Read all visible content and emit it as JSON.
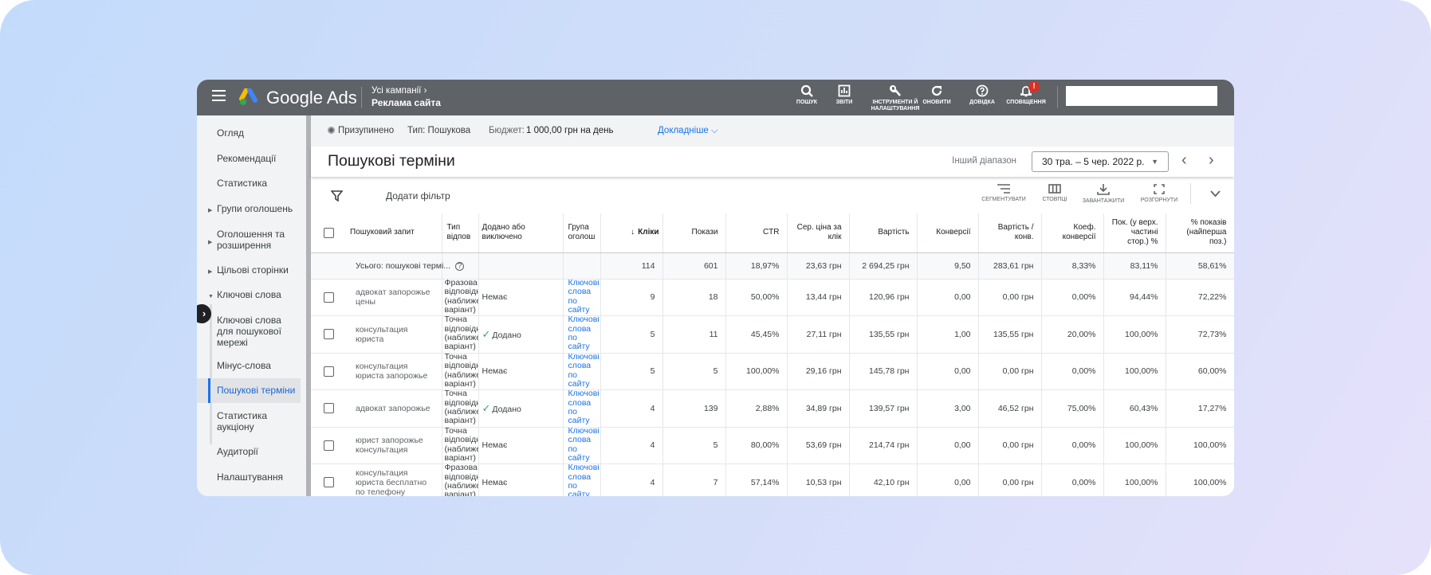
{
  "colors": {
    "header": "#5f6368",
    "accent": "#1a73e8",
    "added": "#34a853",
    "badge": "#d93025"
  },
  "header": {
    "brand": "Google Ads",
    "breadcrumb": {
      "parent": "Усі кампанії",
      "current": "Реклама сайта"
    },
    "buttons": [
      {
        "icon": "search-icon",
        "label": "пошук"
      },
      {
        "icon": "reports-icon",
        "label": "звіти"
      },
      {
        "icon": "wrench-icon",
        "label": "інструменти й налаштування"
      },
      {
        "icon": "refresh-icon",
        "label": "оновити"
      },
      {
        "icon": "help-icon",
        "label": "довідка"
      },
      {
        "icon": "bell-icon",
        "label": "сповіщення",
        "badge": "!"
      }
    ]
  },
  "sidebar": {
    "items": [
      {
        "label": "Огляд"
      },
      {
        "label": "Рекомендації"
      },
      {
        "label": "Статистика"
      },
      {
        "label": "Групи оголошень",
        "expandable": true
      },
      {
        "label": "Оголошення та розширення",
        "expandable": true
      },
      {
        "label": "Цільові сторінки",
        "expandable": true
      },
      {
        "label": "Ключові слова",
        "expanded": true
      },
      {
        "label": "Ключові слова для пошукової мережі",
        "sub": true
      },
      {
        "label": "Мінус-слова",
        "sub": true
      },
      {
        "label": "Пошукові терміни",
        "sub": true,
        "active": true
      },
      {
        "label": "Статистика аукціону",
        "sub": true
      },
      {
        "label": "Аудиторії"
      },
      {
        "label": "Налаштування"
      }
    ]
  },
  "campaign": {
    "status": "Призупинено",
    "type": "Тип: Пошукова",
    "budget_label": "Бюджет:",
    "budget": "1 000,00 грн на день",
    "more": "Докладніше"
  },
  "page": {
    "title": "Пошукові терміни",
    "range_label": "Інший діапазон",
    "date_range": "30 тра. – 5 чер. 2022 р."
  },
  "toolbar": {
    "add_filter": "Додати фільтр",
    "segment": "сегментувати",
    "columns": "стовпці",
    "download": "завантажити",
    "expand": "розгорнути"
  },
  "table": {
    "columns": [
      "Пошуковий запит",
      "Тип відпов",
      "Додано або виключено",
      "Група оголош",
      "Кліки",
      "Покази",
      "CTR",
      "Сер. ціна за клік",
      "Вартість",
      "Конверсії",
      "Вартість / конв.",
      "Коеф. конверсії",
      "Пок. (у верх. частині стор.) %",
      "% показів (найперша поз.)"
    ],
    "sorted_column": "Кліки",
    "sort_direction": "descending",
    "total": [
      "Усього: пошукові термі...",
      "",
      "",
      "",
      "114",
      "601",
      "18,97%",
      "23,63 грн",
      "2 694,25 грн",
      "9,50",
      "283,61 грн",
      "8,33%",
      "83,11%",
      "58,61%"
    ],
    "rows": [
      [
        "адвокат запорожье цены",
        "Фразова відповідність (наближений варіант)",
        "Немає",
        "Ключові слова по сайту",
        "9",
        "18",
        "50,00%",
        "13,44 грн",
        "120,96 грн",
        "0,00",
        "0,00 грн",
        "0,00%",
        "94,44%",
        "72,22%"
      ],
      [
        "консультация юриста",
        "Точна відповідність (наближений варіант)",
        "Додано",
        "Ключові слова по сайту",
        "5",
        "11",
        "45,45%",
        "27,11 грн",
        "135,55 грн",
        "1,00",
        "135,55 грн",
        "20,00%",
        "100,00%",
        "72,73%"
      ],
      [
        "консультация юриста запорожье",
        "Точна відповідність (наближений варіант)",
        "Немає",
        "Ключові слова по сайту",
        "5",
        "5",
        "100,00%",
        "29,16 грн",
        "145,78 грн",
        "0,00",
        "0,00 грн",
        "0,00%",
        "100,00%",
        "60,00%"
      ],
      [
        "адвокат запорожье",
        "Точна відповідність (наближений варіант)",
        "Додано",
        "Ключові слова по сайту",
        "4",
        "139",
        "2,88%",
        "34,89 грн",
        "139,57 грн",
        "3,00",
        "46,52 грн",
        "75,00%",
        "60,43%",
        "17,27%"
      ],
      [
        "юрист запорожье консультация",
        "Точна відповідність (наближений варіант)",
        "Немає",
        "Ключові слова по сайту",
        "4",
        "5",
        "80,00%",
        "53,69 грн",
        "214,74 грн",
        "0,00",
        "0,00 грн",
        "0,00%",
        "100,00%",
        "100,00%"
      ],
      [
        "консультация юриста бесплатно по телефону",
        "Фразова відповідність (наближений варіант)",
        "Немає",
        "Ключові слова по сайту",
        "4",
        "7",
        "57,14%",
        "10,53 грн",
        "42,10 грн",
        "0,00",
        "0,00 грн",
        "0,00%",
        "100,00%",
        "100,00%"
      ]
    ]
  }
}
